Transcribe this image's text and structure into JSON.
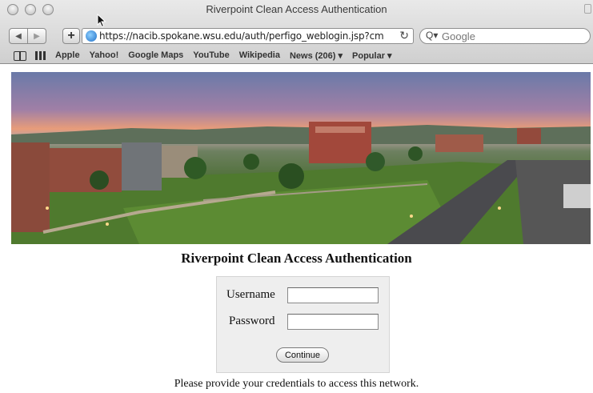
{
  "window": {
    "title": "Riverpoint Clean Access Authentication"
  },
  "toolbar": {
    "back_symbol": "◀",
    "forward_symbol": "▶",
    "add_symbol": "+",
    "url": "https://nacib.spokane.wsu.edu/auth/perfigo_weblogin.jsp?cm",
    "reload_symbol": "↻",
    "search_symbol": "Q▾",
    "search_placeholder": "Google"
  },
  "bookmarks": {
    "items": [
      "Apple",
      "Yahoo!",
      "Google Maps",
      "YouTube",
      "Wikipedia",
      "News (206) ▾",
      "Popular ▾"
    ]
  },
  "page": {
    "heading": "Riverpoint Clean Access Authentication",
    "username_label": "Username",
    "username_value": "",
    "password_label": "Password",
    "password_value": "",
    "continue_label": "Continue",
    "footer": "Please provide your credentials to access this network."
  },
  "icons": {
    "window_controls": [
      "close-icon",
      "minimize-icon",
      "maximize-icon"
    ],
    "address": "globe-icon",
    "bookmarks_book": "book-icon",
    "top_sites": "grid-icon"
  }
}
